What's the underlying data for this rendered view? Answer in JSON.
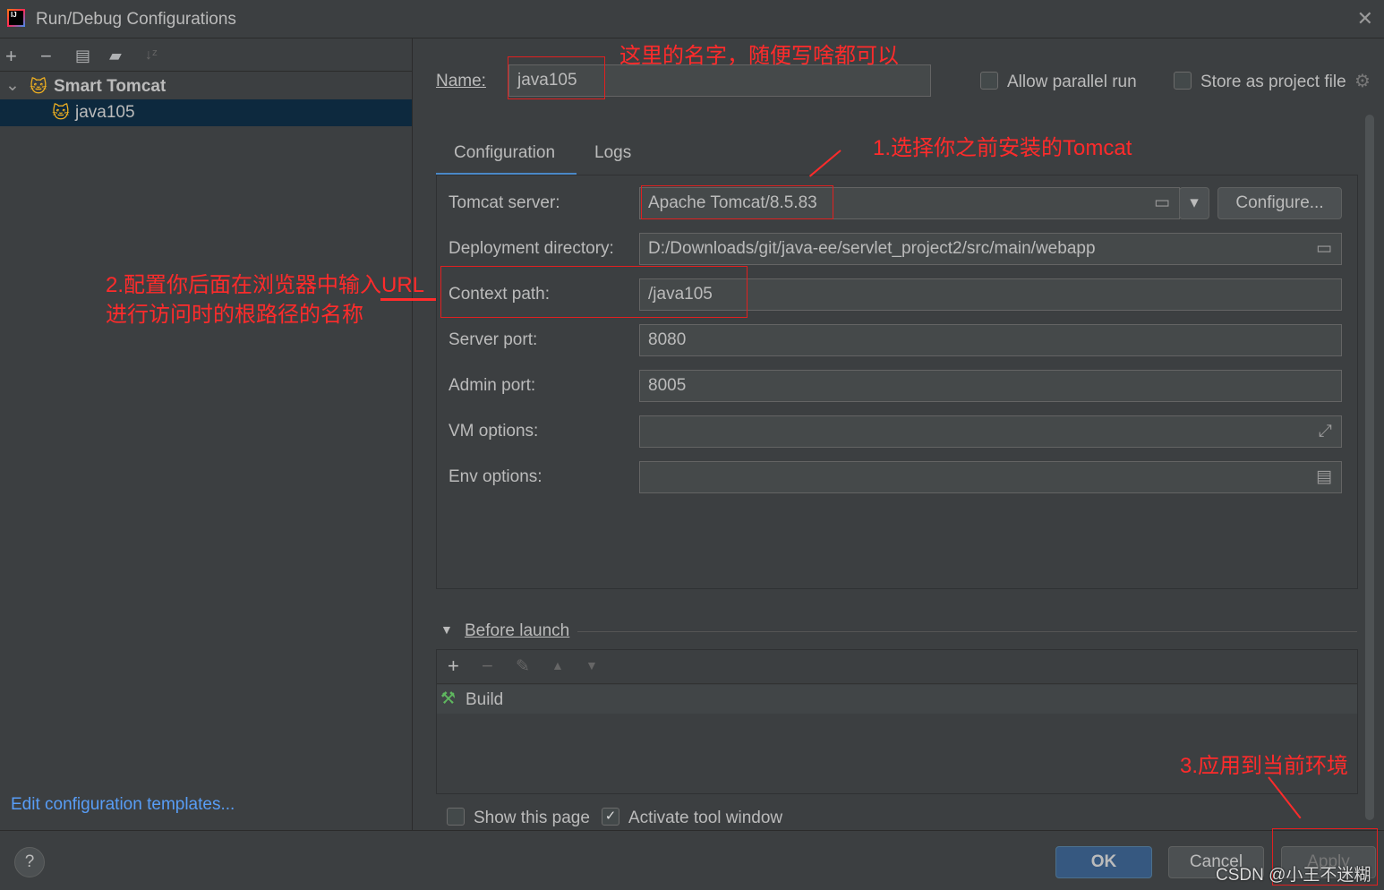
{
  "window": {
    "title": "Run/Debug Configurations",
    "close": "✕"
  },
  "sidebar": {
    "group": "Smart Tomcat",
    "items": [
      {
        "label": "java105",
        "selected": true
      }
    ],
    "edit_templates": "Edit configuration templates..."
  },
  "form": {
    "name_label": "Name:",
    "name_value": "java105",
    "allow_parallel": "Allow parallel run",
    "store_project": "Store as project file",
    "tabs": [
      {
        "label": "Configuration",
        "active": true
      },
      {
        "label": "Logs",
        "active": false
      }
    ],
    "tomcat_server_label": "Tomcat server:",
    "tomcat_server_value": "Apache Tomcat/8.5.83",
    "configure": "Configure...",
    "deploy_label": "Deployment directory:",
    "deploy_value": "D:/Downloads/git/java-ee/servlet_project2/src/main/webapp",
    "context_label": "Context path:",
    "context_value": "/java105",
    "server_port_label": "Server port:",
    "server_port_value": "8080",
    "admin_port_label": "Admin port:",
    "admin_port_value": "8005",
    "vm_label": "VM options:",
    "vm_value": "",
    "env_label": "Env options:",
    "env_value": ""
  },
  "before_launch": {
    "title": "Before launch",
    "items": [
      "Build"
    ],
    "show_page": "Show this page",
    "show_page_checked": false,
    "activate_tool": "Activate tool window",
    "activate_tool_checked": true
  },
  "buttons": {
    "ok": "OK",
    "cancel": "Cancel",
    "apply": "Apply",
    "help": "?"
  },
  "annotations": {
    "a0": "这里的名字，随便写啥都可以",
    "a1": "1.选择你之前安装的Tomcat",
    "a2_line1": "2.配置你后面在浏览器中输入URL",
    "a2_line2": "进行访问时的根路径的名称",
    "a3": "3.应用到当前环境"
  },
  "watermark": "CSDN @小王不迷糊",
  "colors": {
    "accent": "#4a88c7",
    "selection": "#0d293e",
    "annotation": "#ff2b2b",
    "ok": "#365880"
  }
}
